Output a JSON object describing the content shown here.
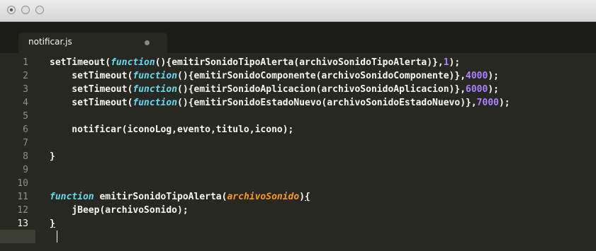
{
  "window": {
    "buttons": [
      "close",
      "minimize",
      "zoom"
    ]
  },
  "tabs": [
    {
      "label": "notificar.js",
      "modified": true
    }
  ],
  "editor": {
    "line_numbers": [
      "1",
      "2",
      "3",
      "4",
      "5",
      "6",
      "7",
      "8",
      "9",
      "10",
      "11",
      "12",
      "13"
    ],
    "active_line": "13",
    "lines": [
      [
        {
          "t": "setTimeout(",
          "c": "plain"
        },
        {
          "t": "function",
          "c": "kw"
        },
        {
          "t": "(){emitirSonidoTipoAlerta(archivoSonidoTipoAlerta)},",
          "c": "plain"
        },
        {
          "t": "1",
          "c": "num"
        },
        {
          "t": ");",
          "c": "plain"
        }
      ],
      [
        {
          "t": "    setTimeout(",
          "c": "plain"
        },
        {
          "t": "function",
          "c": "kw"
        },
        {
          "t": "(){emitirSonidoComponente(archivoSonidoComponente)},",
          "c": "plain"
        },
        {
          "t": "4000",
          "c": "num"
        },
        {
          "t": ");",
          "c": "plain"
        }
      ],
      [
        {
          "t": "    setTimeout(",
          "c": "plain"
        },
        {
          "t": "function",
          "c": "kw"
        },
        {
          "t": "(){emitirSonidoAplicacion(archivoSonidoAplicacion)},",
          "c": "plain"
        },
        {
          "t": "6000",
          "c": "num"
        },
        {
          "t": ");",
          "c": "plain"
        }
      ],
      [
        {
          "t": "    setTimeout(",
          "c": "plain"
        },
        {
          "t": "function",
          "c": "kw"
        },
        {
          "t": "(){emitirSonidoEstadoNuevo(archivoSonidoEstadoNuevo)},",
          "c": "plain"
        },
        {
          "t": "7000",
          "c": "num"
        },
        {
          "t": ");",
          "c": "plain"
        }
      ],
      [],
      [
        {
          "t": "    notificar(iconoLog,evento,titulo,icono);",
          "c": "plain"
        }
      ],
      [],
      [
        {
          "t": "}",
          "c": "plain"
        }
      ],
      [],
      [],
      [
        {
          "t": "function",
          "c": "kw"
        },
        {
          "t": " emitirSonidoTipoAlerta(",
          "c": "plain"
        },
        {
          "t": "archivoSonido",
          "c": "param"
        },
        {
          "t": ")",
          "c": "plain"
        },
        {
          "t": "{",
          "c": "underline"
        }
      ],
      [
        {
          "t": "    jBeep(archivoSonido);",
          "c": "plain"
        }
      ],
      [
        {
          "t": "}",
          "c": "underline"
        }
      ]
    ]
  },
  "colors": {
    "background": "#272822",
    "keyword": "#66d9ef",
    "number": "#ae81ff",
    "parameter": "#fd971f",
    "foreground": "#f8f8f2",
    "line_number": "#8f908a"
  }
}
